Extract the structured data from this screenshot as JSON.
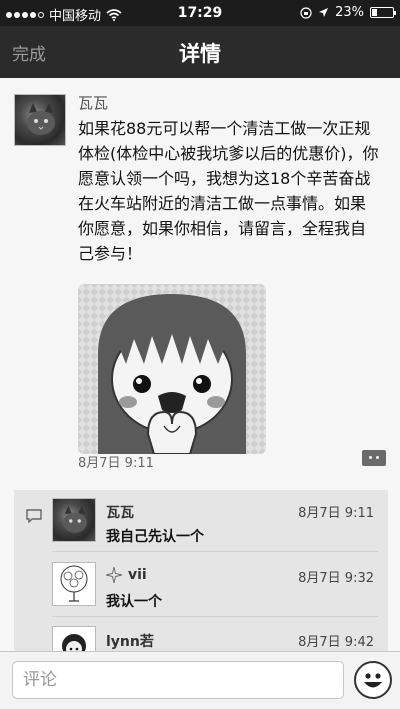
{
  "status_bar": {
    "carrier": "中国移动",
    "time": "17:29",
    "battery": "23%",
    "battery_level": 0.23,
    "signal_bars_filled": 4
  },
  "nav": {
    "back_label": "完成",
    "title": "详情"
  },
  "post": {
    "author": "瓦瓦",
    "text": "如果花88元可以帮一个清洁工做一次正规体检(体检中心被我坑爹以后的优惠价)，你愿意认领一个吗，我想为这18个辛苦奋战在火车站附近的清洁工做一点事情。如果你愿意，如果你相信，请留言，全程我自己参与！",
    "time": "8月7日 9:11"
  },
  "comments": [
    {
      "name": "瓦瓦",
      "time": "8月7日 9:11",
      "text": "我自己先认一个"
    },
    {
      "name": "vii",
      "time": "8月7日 9:32",
      "text": "我认一个"
    },
    {
      "name": "lynn若",
      "time": "8月7日 9:42",
      "text": ""
    }
  ],
  "input": {
    "placeholder": "评论"
  },
  "colors": {
    "status_bar_bg": "#1c1c1c",
    "nav_bg": "#2b2b2b",
    "page_bg": "#f6f6f6",
    "comments_bg": "#e5e5e5"
  }
}
